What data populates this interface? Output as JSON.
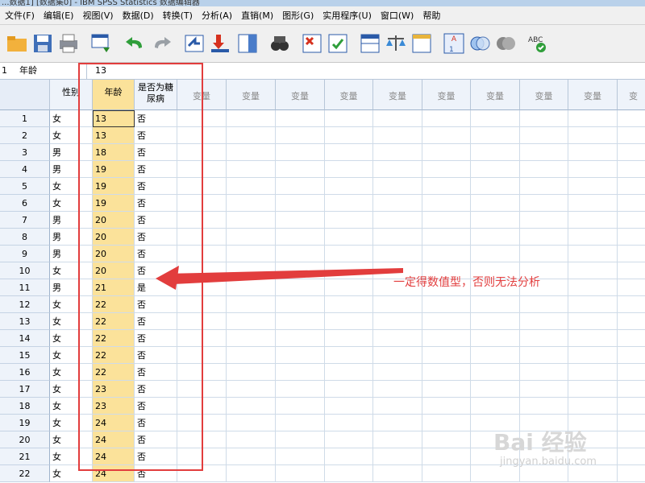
{
  "window": {
    "title": "...数据1] [数据集0] - IBM SPSS Statistics 数据编辑器"
  },
  "menu": [
    "文件(F)",
    "编辑(E)",
    "视图(V)",
    "数据(D)",
    "转换(T)",
    "分析(A)",
    "直销(M)",
    "图形(G)",
    "实用程序(U)",
    "窗口(W)",
    "帮助"
  ],
  "toolbar": [
    {
      "icon": "open-folder-icon"
    },
    {
      "icon": "save-icon"
    },
    {
      "icon": "print-icon"
    },
    {
      "icon": "dialog-recall-icon"
    },
    {
      "icon": "undo-icon"
    },
    {
      "icon": "redo-icon"
    },
    {
      "icon": "goto-case-icon"
    },
    {
      "icon": "goto-variable-icon"
    },
    {
      "icon": "variables-icon"
    },
    {
      "icon": "find-icon"
    },
    {
      "icon": "insert-cases-icon"
    },
    {
      "icon": "insert-variable-icon"
    },
    {
      "icon": "split-file-icon"
    },
    {
      "icon": "weight-cases-icon"
    },
    {
      "icon": "select-cases-icon"
    },
    {
      "icon": "value-labels-icon"
    },
    {
      "icon": "use-sets-icon"
    },
    {
      "icon": "show-all-variables-icon"
    },
    {
      "icon": "spell-check-icon"
    }
  ],
  "cellbar": {
    "ref_row": "1",
    "ref_var": "年龄",
    "value": "13"
  },
  "columns": [
    "性别",
    "年龄",
    "是否为糖尿病",
    "变量",
    "变量",
    "变量",
    "变量",
    "变量",
    "变量",
    "变量",
    "变量",
    "变量",
    "变"
  ],
  "rows": [
    {
      "n": "1",
      "sex": "女",
      "age": "13",
      "dm": "否"
    },
    {
      "n": "2",
      "sex": "女",
      "age": "13",
      "dm": "否"
    },
    {
      "n": "3",
      "sex": "男",
      "age": "18",
      "dm": "否"
    },
    {
      "n": "4",
      "sex": "男",
      "age": "19",
      "dm": "否"
    },
    {
      "n": "5",
      "sex": "女",
      "age": "19",
      "dm": "否"
    },
    {
      "n": "6",
      "sex": "女",
      "age": "19",
      "dm": "否"
    },
    {
      "n": "7",
      "sex": "男",
      "age": "20",
      "dm": "否"
    },
    {
      "n": "8",
      "sex": "男",
      "age": "20",
      "dm": "否"
    },
    {
      "n": "9",
      "sex": "男",
      "age": "20",
      "dm": "否"
    },
    {
      "n": "10",
      "sex": "女",
      "age": "20",
      "dm": "否"
    },
    {
      "n": "11",
      "sex": "男",
      "age": "21",
      "dm": "是"
    },
    {
      "n": "12",
      "sex": "女",
      "age": "22",
      "dm": "否"
    },
    {
      "n": "13",
      "sex": "女",
      "age": "22",
      "dm": "否"
    },
    {
      "n": "14",
      "sex": "女",
      "age": "22",
      "dm": "否"
    },
    {
      "n": "15",
      "sex": "女",
      "age": "22",
      "dm": "否"
    },
    {
      "n": "16",
      "sex": "女",
      "age": "22",
      "dm": "否"
    },
    {
      "n": "17",
      "sex": "女",
      "age": "23",
      "dm": "否"
    },
    {
      "n": "18",
      "sex": "女",
      "age": "23",
      "dm": "否"
    },
    {
      "n": "19",
      "sex": "女",
      "age": "24",
      "dm": "否"
    },
    {
      "n": "20",
      "sex": "女",
      "age": "24",
      "dm": "否"
    },
    {
      "n": "21",
      "sex": "女",
      "age": "24",
      "dm": "否"
    },
    {
      "n": "22",
      "sex": "女",
      "age": "24",
      "dm": "否"
    }
  ],
  "annotation": {
    "text": "一定得数值型，否则无法分析",
    "color": "#e23d3d"
  },
  "watermark": {
    "brand": "Bai 经验",
    "url": "jingyan.baidu.com"
  },
  "colors": {
    "highlight_column": "#fbe29a",
    "header_bg": "#eef3fa",
    "grid_line": "#cfdbe8"
  }
}
